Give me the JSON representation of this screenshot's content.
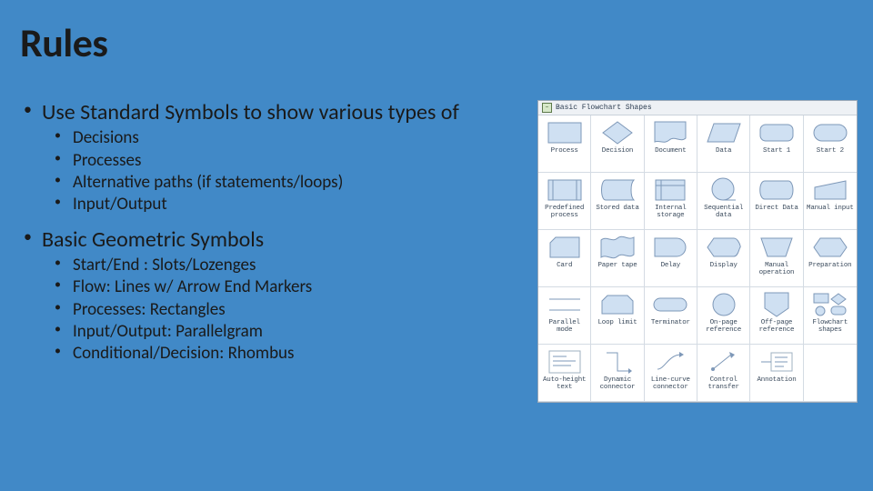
{
  "title": "Rules",
  "bullets": {
    "b1": "Use Standard Symbols to show various types of",
    "b1sub": [
      "Decisions",
      "Processes",
      "Alternative paths (if statements/loops)",
      "Input/Output"
    ],
    "b2": "Basic Geometric Symbols",
    "b2sub": [
      "Start/End : Slots/Lozenges",
      "Flow: Lines w/ Arrow End Markers",
      "Processes: Rectangles",
      "Input/Output: Parallelgram",
      "Conditional/Decision: Rhombus"
    ]
  },
  "panel": {
    "title": "Basic Flowchart Shapes",
    "cells": [
      "Process",
      "Decision",
      "Document",
      "Data",
      "Start 1",
      "Start 2",
      "Predefined process",
      "Stored data",
      "Internal storage",
      "Sequential data",
      "Direct Data",
      "Manual input",
      "Card",
      "Paper tape",
      "Delay",
      "Display",
      "Manual operation",
      "Preparation",
      "Parallel mode",
      "Loop limit",
      "Terminator",
      "On-page reference",
      "Off-page reference",
      "Flowchart shapes",
      "Auto-height text",
      "Dynamic connector",
      "Line-curve connector",
      "Control transfer",
      "Annotation",
      ""
    ]
  }
}
